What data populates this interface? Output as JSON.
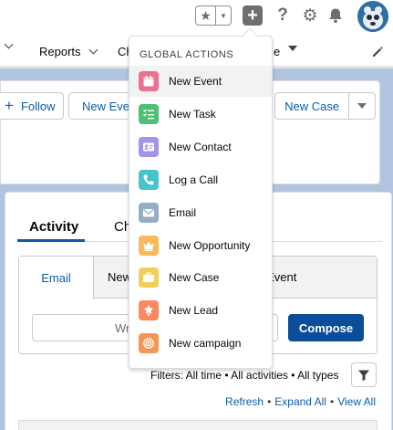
{
  "header": {
    "icons": [
      "star-icon",
      "chevron-down-icon",
      "plus-icon",
      "help-icon",
      "gear-icon",
      "bell-icon",
      "avatar"
    ]
  },
  "nav": {
    "reports_label": "Reports",
    "partial_label": "Ch",
    "partial_label_2": "e"
  },
  "record_actions": {
    "follow_label": "Follow",
    "new_event_label": "New Event",
    "new_case_label": "New Case"
  },
  "activity": {
    "tabs": [
      {
        "label": "Activity"
      },
      {
        "label": "Ch"
      }
    ],
    "publisher_tabs": [
      {
        "label": "Email"
      },
      {
        "label": "New"
      },
      {
        "label": "v Event"
      }
    ],
    "write_placeholder": "Wr",
    "compose_label": "Compose",
    "filters_text": "Filters: All time • All activities • All types",
    "links": {
      "refresh": "Refresh",
      "expand_all": "Expand All",
      "view_all": "View All",
      "separator": "•"
    }
  },
  "global_actions": {
    "heading": "GLOBAL ACTIONS",
    "items": [
      {
        "label": "New Event",
        "icon": "calendar-icon",
        "color": "#eb7092"
      },
      {
        "label": "New Task",
        "icon": "task-icon",
        "color": "#4bc076"
      },
      {
        "label": "New Contact",
        "icon": "contact-icon",
        "color": "#a094ed"
      },
      {
        "label": "Log a Call",
        "icon": "phone-icon",
        "color": "#48c3cc"
      },
      {
        "label": "Email",
        "icon": "email-icon",
        "color": "#95aec5"
      },
      {
        "label": "New Opportunity",
        "icon": "crown-icon",
        "color": "#fcb95b"
      },
      {
        "label": "New Case",
        "icon": "briefcase-icon",
        "color": "#f2cf5b"
      },
      {
        "label": "New Lead",
        "icon": "lead-icon",
        "color": "#f88962"
      },
      {
        "label": "New campaign",
        "icon": "campaign-icon",
        "color": "#f49756"
      }
    ]
  },
  "colors": {
    "brand_blue": "#0b5cab",
    "compose_bg": "#0b4d99",
    "backdrop": "#b0c4df"
  }
}
